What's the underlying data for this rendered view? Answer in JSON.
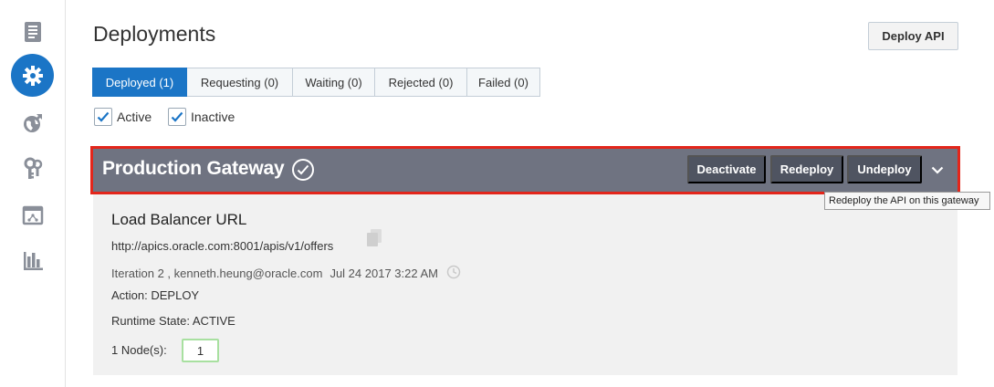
{
  "sidebar": {
    "items": [
      {
        "icon": "document-list-icon",
        "active": false
      },
      {
        "icon": "gear-icon",
        "active": true
      },
      {
        "icon": "globe-icon",
        "active": false
      },
      {
        "icon": "keys-icon",
        "active": false
      },
      {
        "icon": "app-window-icon",
        "active": false
      },
      {
        "icon": "bar-chart-icon",
        "active": false
      }
    ]
  },
  "header": {
    "title": "Deployments",
    "deploy_button": "Deploy API"
  },
  "tabs": [
    {
      "label": "Deployed (1)",
      "selected": true
    },
    {
      "label": "Requesting (0)",
      "selected": false
    },
    {
      "label": "Waiting (0)",
      "selected": false
    },
    {
      "label": "Rejected (0)",
      "selected": false
    },
    {
      "label": "Failed (0)",
      "selected": false
    }
  ],
  "filters": {
    "active": {
      "label": "Active",
      "checked": true
    },
    "inactive": {
      "label": "Inactive",
      "checked": true
    }
  },
  "gateway": {
    "name": "Production Gateway",
    "buttons": {
      "deactivate": "Deactivate",
      "redeploy": "Redeploy",
      "undeploy": "Undeploy"
    },
    "tooltip": "Redeploy the API on this gateway"
  },
  "details": {
    "lb_title": "Load Balancer URL",
    "lb_url": "http://apics.oracle.com:8001/apis/v1/offers",
    "iteration": "Iteration 2 , kenneth.heung@oracle.com",
    "date": "Jul 24 2017 3:22 AM",
    "action": "Action: DEPLOY",
    "runtime_state": "Runtime State: ACTIVE",
    "nodes_label": "1 Node(s):",
    "nodes_value": "1"
  },
  "colors": {
    "accent": "#1b75c6",
    "gateway_bar": "#6f7381",
    "gateway_button": "#4f5461",
    "highlight_outline": "#e3261b",
    "details_bg": "#f1f1f1",
    "nodes_border": "#a8e0a0"
  }
}
